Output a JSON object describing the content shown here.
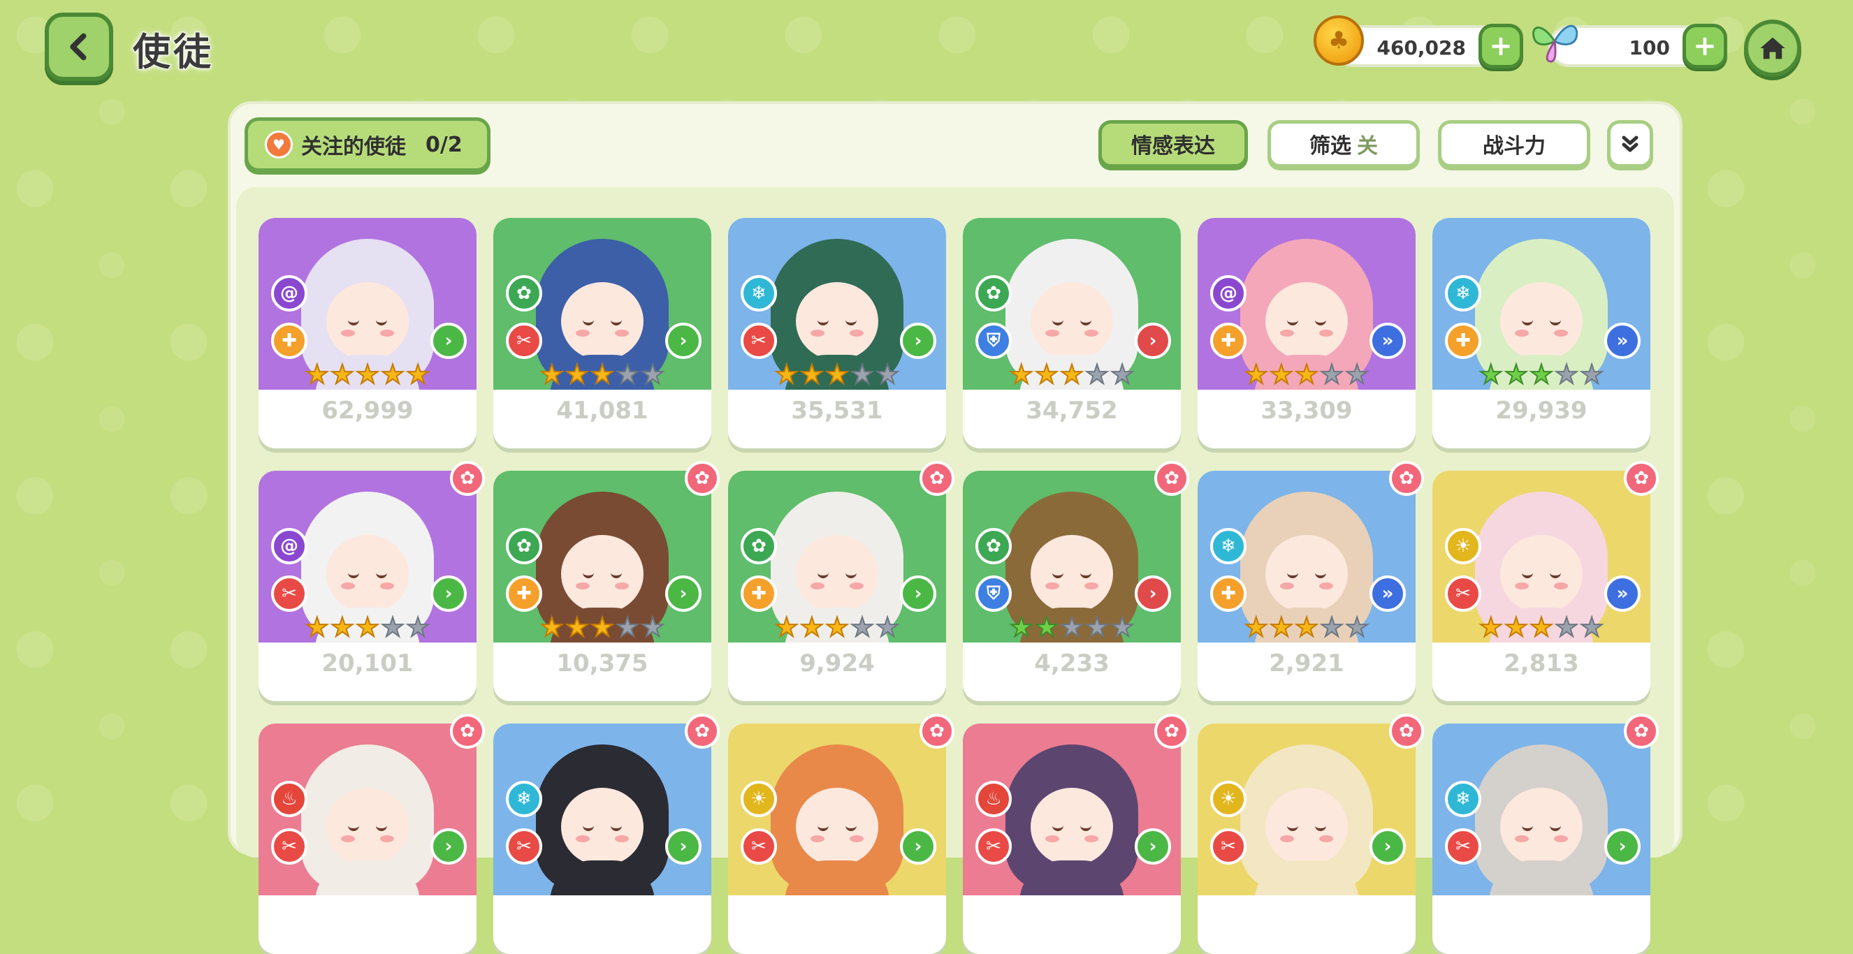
{
  "header": {
    "title": "使徒",
    "gold": "460,028",
    "gems": "100",
    "plus": "+"
  },
  "toolbar": {
    "follow_label": "关注的使徒",
    "follow_count": "0/2",
    "emotion": "情感表达",
    "filter": "筛选",
    "filter_state": "关",
    "sort": "战斗力"
  },
  "colors": {
    "purple": "#b173e0",
    "green": "#5fbd6c",
    "blue": "#7db4ea",
    "pink": "#ec7c92",
    "yellow": "#ecd76a",
    "element_purple": "#8a48d1",
    "element_green": "#3da853",
    "element_cyan": "#2fb8d6",
    "element_yellow": "#e2b61d",
    "element_red": "#e4463a",
    "role_orange": "#f5a02a",
    "role_red": "#e94a45",
    "role_blue": "#3d7fe3",
    "pos_green": "#4bb845",
    "pos_red": "#e14a4a",
    "pos_blue": "#3d6fe0",
    "favorite_flower": "#f2677a"
  },
  "cards": [
    {
      "bg": "purple",
      "element": "spiral-icon",
      "role": "cross-icon",
      "position": "chevron-right-icon",
      "stars": 5,
      "star_color": "gold",
      "power": "62,999",
      "flower": false
    },
    {
      "bg": "green",
      "element": "clover-icon",
      "role": "sword-icon",
      "position": "chevron-right-icon",
      "stars": 3,
      "star_color": "gold",
      "power": "41,081",
      "flower": false
    },
    {
      "bg": "blue",
      "element": "snowflake-icon",
      "role": "sword-icon",
      "position": "chevron-right-icon",
      "stars": 3,
      "star_color": "gold",
      "power": "35,531",
      "flower": false
    },
    {
      "bg": "green",
      "element": "clover-icon",
      "role": "shield-icon",
      "position": "chevron-right-icon",
      "stars": 3,
      "star_color": "gold",
      "power": "34,752",
      "flower": false
    },
    {
      "bg": "purple",
      "element": "spiral-icon",
      "role": "cross-icon",
      "position": "double-chevron-icon",
      "stars": 3,
      "star_color": "gold",
      "power": "33,309",
      "flower": false
    },
    {
      "bg": "blue",
      "element": "snowflake-icon",
      "role": "cross-icon",
      "position": "double-chevron-icon",
      "stars": 3,
      "star_color": "green",
      "power": "29,939",
      "flower": false
    },
    {
      "bg": "purple",
      "element": "spiral-icon",
      "role": "sword-icon",
      "position": "chevron-right-icon",
      "stars": 3,
      "star_color": "gold",
      "power": "20,101",
      "flower": true
    },
    {
      "bg": "green",
      "element": "clover-icon",
      "role": "cross-icon",
      "position": "chevron-right-icon",
      "stars": 3,
      "star_color": "gold",
      "power": "10,375",
      "flower": true
    },
    {
      "bg": "green",
      "element": "clover-icon",
      "role": "cross-icon",
      "position": "chevron-right-icon",
      "stars": 3,
      "star_color": "gold",
      "power": "9,924",
      "flower": true
    },
    {
      "bg": "green",
      "element": "clover-icon",
      "role": "shield-icon",
      "position": "chevron-right-icon",
      "stars": 2,
      "star_color": "green",
      "power": "4,233",
      "flower": true
    },
    {
      "bg": "blue",
      "element": "snowflake-icon",
      "role": "cross-icon",
      "position": "double-chevron-icon",
      "stars": 3,
      "star_color": "gold",
      "power": "2,921",
      "flower": true
    },
    {
      "bg": "yellow",
      "element": "sun-icon",
      "role": "sword-icon",
      "position": "double-chevron-icon",
      "stars": 3,
      "star_color": "gold",
      "power": "2,813",
      "flower": true
    },
    {
      "bg": "pink",
      "element": "flame-icon",
      "role": "sword-icon",
      "position": "chevron-right-icon",
      "stars": 0,
      "star_color": "gold",
      "power": "",
      "flower": true
    },
    {
      "bg": "blue",
      "element": "snowflake-icon",
      "role": "sword-icon",
      "position": "chevron-right-icon",
      "stars": 0,
      "star_color": "gold",
      "power": "",
      "flower": true
    },
    {
      "bg": "yellow",
      "element": "sun-icon",
      "role": "sword-icon",
      "position": "chevron-right-icon",
      "stars": 0,
      "star_color": "gold",
      "power": "",
      "flower": true
    },
    {
      "bg": "pink",
      "element": "flame-icon",
      "role": "sword-icon",
      "position": "chevron-right-icon",
      "stars": 0,
      "star_color": "gold",
      "power": "",
      "flower": true
    },
    {
      "bg": "yellow",
      "element": "sun-icon",
      "role": "sword-icon",
      "position": "chevron-right-icon",
      "stars": 0,
      "star_color": "gold",
      "power": "",
      "flower": true
    },
    {
      "bg": "blue",
      "element": "snowflake-icon",
      "role": "sword-icon",
      "position": "chevron-right-icon",
      "stars": 0,
      "star_color": "gold",
      "power": "",
      "flower": true
    }
  ]
}
